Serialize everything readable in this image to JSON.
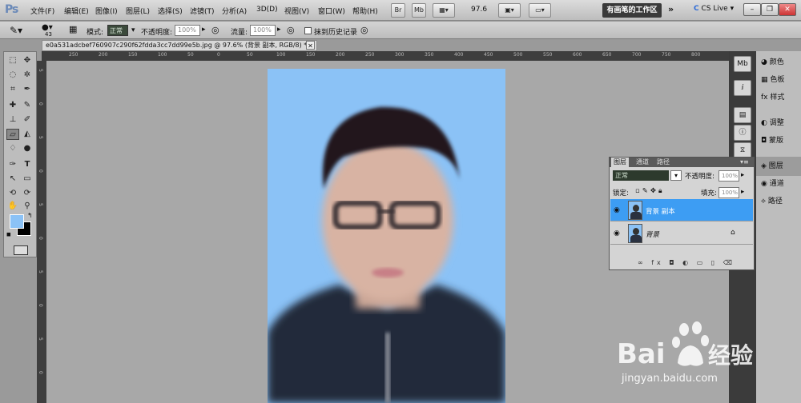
{
  "app": {
    "logo": "Ps"
  },
  "menu": [
    "文件(F)",
    "编辑(E)",
    "图像(I)",
    "图层(L)",
    "选择(S)",
    "滤镜(T)",
    "分析(A)",
    "3D(D)",
    "视图(V)",
    "窗口(W)",
    "帮助(H)"
  ],
  "menubar_buttons": {
    "bridge": "Br",
    "minibridge": "Mb",
    "zoom": "97.6"
  },
  "workspace": "有画笔的工作区",
  "cslive": "CS Live",
  "options": {
    "brush_size": "43",
    "mode_label": "模式:",
    "mode_value": "正常",
    "opacity_label": "不透明度:",
    "opacity_value": "100%",
    "flow_label": "流量:",
    "flow_value": "100%",
    "history_label": "抹到历史记录"
  },
  "document": {
    "tab": "e0a531adcbef760907c290f62fdda3cc7dd99e5b.jpg @ 97.6% (背景 副本, RGB/8) *"
  },
  "ruler_top": [
    "250",
    "200",
    "150",
    "100",
    "50",
    "0",
    "50",
    "100",
    "150",
    "200",
    "250",
    "300",
    "350",
    "400",
    "450",
    "500",
    "550",
    "600",
    "650",
    "700",
    "750",
    "800"
  ],
  "ruler_left": [
    "5",
    "0",
    "5",
    "0",
    "5",
    "0",
    "5",
    "0",
    "5",
    "0"
  ],
  "panel_items": [
    {
      "label": "颜色",
      "icon": "palette-icon",
      "selected": false
    },
    {
      "label": "色板",
      "icon": "swatches-icon",
      "selected": false
    },
    {
      "label": "样式",
      "icon": "styles-icon",
      "selected": false
    },
    {
      "label": "调整",
      "icon": "adjustments-icon",
      "selected": false
    },
    {
      "label": "蒙版",
      "icon": "masks-icon",
      "selected": false
    },
    {
      "label": "图层",
      "icon": "layers-icon",
      "selected": true
    },
    {
      "label": "通道",
      "icon": "channels-icon",
      "selected": false
    },
    {
      "label": "路径",
      "icon": "paths-icon",
      "selected": false
    }
  ],
  "layers_panel": {
    "tabs": [
      "图层",
      "通道",
      "路径"
    ],
    "blend_mode": "正常",
    "opacity_label": "不透明度:",
    "opacity_value": "100%",
    "lock_label": "锁定:",
    "fill_label": "填充:",
    "fill_value": "100%",
    "layers": [
      {
        "name": "背景 副本",
        "selected": true
      },
      {
        "name": "背景",
        "selected": false,
        "locked": true
      }
    ],
    "footer": "∞ fx ◘ ◐ ▭ ▯ ⌫"
  },
  "watermark": {
    "brand": "Bai",
    "brand2": "经验",
    "url": "jingyan.baidu.com"
  },
  "colors": {
    "photo_bg": "#8bc2f6",
    "selected_layer": "#3d9df3"
  }
}
